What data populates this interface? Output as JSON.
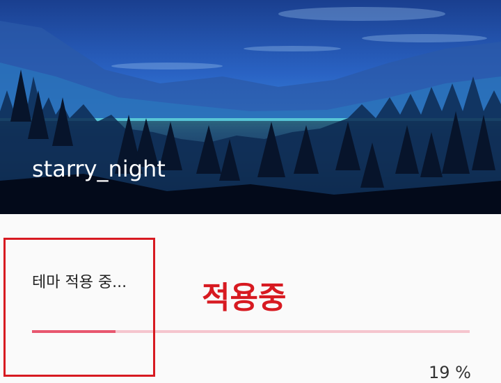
{
  "theme": {
    "name": "starry_night"
  },
  "apply_dialog": {
    "status_text": "테마 적용 중...",
    "progress_fraction": 0.19,
    "progress_percent_label": "19 %"
  },
  "annotation": {
    "label": "적용중"
  },
  "colors": {
    "progress_fill": "#e8576f",
    "progress_track": "#f5c5ce",
    "annotation_red": "#d71a21",
    "background": "#fafafa"
  }
}
